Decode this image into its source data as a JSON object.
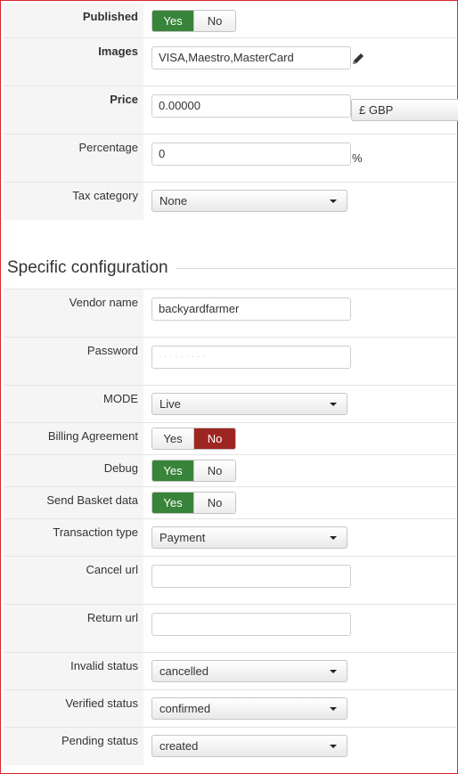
{
  "general": {
    "published": {
      "label": "Published",
      "yes": "Yes",
      "no": "No",
      "value": "Yes"
    },
    "images": {
      "label": "Images",
      "value": "VISA,Maestro,MasterCard",
      "edit_icon": "pencil-icon"
    },
    "price": {
      "label": "Price",
      "value": "0.00000",
      "currency": "£ GBP"
    },
    "percentage": {
      "label": "Percentage",
      "value": "0",
      "suffix": "%"
    },
    "tax_category": {
      "label": "Tax category",
      "value": "None"
    }
  },
  "section": {
    "title": "Specific configuration"
  },
  "config": {
    "vendor_name": {
      "label": "Vendor name",
      "value": "backyardfarmer"
    },
    "password": {
      "label": "Password",
      "value": "· · · · · · · · ·"
    },
    "mode": {
      "label": "MODE",
      "value": "Live"
    },
    "billing_agreement": {
      "label": "Billing Agreement",
      "yes": "Yes",
      "no": "No",
      "value": "No"
    },
    "debug": {
      "label": "Debug",
      "yes": "Yes",
      "no": "No",
      "value": "Yes"
    },
    "send_basket": {
      "label": "Send Basket data",
      "yes": "Yes",
      "no": "No",
      "value": "Yes"
    },
    "transaction_type": {
      "label": "Transaction type",
      "value": "Payment"
    },
    "cancel_url": {
      "label": "Cancel url",
      "value": ""
    },
    "return_url": {
      "label": "Return url",
      "value": ""
    },
    "invalid_status": {
      "label": "Invalid status",
      "value": "cancelled"
    },
    "verified_status": {
      "label": "Verified status",
      "value": "confirmed"
    },
    "pending_status": {
      "label": "Pending status",
      "value": "created"
    }
  },
  "colors": {
    "green": "#39843b",
    "red": "#9e2622",
    "frame": "#d9272e"
  }
}
